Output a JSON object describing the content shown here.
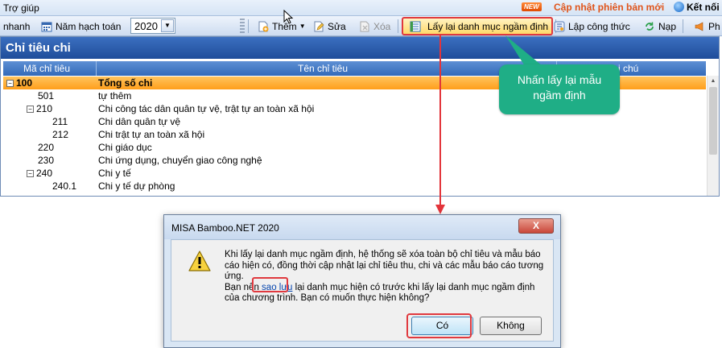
{
  "menubar": {
    "help": "Trợ giúp",
    "new_badge": "NEW",
    "update_link": "Cập nhật phiên bản mới",
    "connect": "Kết nối"
  },
  "toolbar": {
    "quick_label": "nhanh",
    "fiscal_year_label": "Năm hạch toán",
    "fiscal_year_value": "2020",
    "add": "Thêm",
    "edit": "Sửa",
    "delete": "Xóa",
    "restore_default": "Lấy lại danh mục ngầm định",
    "formula": "Lập công thức",
    "load": "Nạp",
    "more": "Ph"
  },
  "panel": {
    "title": "Chỉ tiêu chi",
    "columns": {
      "code": "Mã chỉ tiêu",
      "name": "Tên chỉ tiêu",
      "note": "Ghi chú"
    },
    "rows": [
      {
        "toggle": "−",
        "code": "100",
        "name": "Tổng số chi"
      },
      {
        "toggle": "",
        "code": "501",
        "name": "tự thêm"
      },
      {
        "toggle": "−",
        "code": "210",
        "name": "Chi công tác dân quân tự vệ, trật tự an toàn xã hội"
      },
      {
        "toggle": "",
        "code": "211",
        "name": "Chi dân quân tự vệ"
      },
      {
        "toggle": "",
        "code": "212",
        "name": "Chi trật tự an toàn xã hội"
      },
      {
        "toggle": "",
        "code": "220",
        "name": "Chi giáo dục"
      },
      {
        "toggle": "",
        "code": "230",
        "name": "Chi ứng dụng, chuyển giao công nghệ"
      },
      {
        "toggle": "−",
        "code": "240",
        "name": "Chi y tế"
      },
      {
        "toggle": "",
        "code": "240.1",
        "name": "Chi y tế dự phòng"
      }
    ]
  },
  "callout": {
    "text": "Nhấn lấy lại mẫu ngầm định"
  },
  "dialog": {
    "title": "MISA Bamboo.NET 2020",
    "close": "X",
    "message_line1": "Khi lấy lại danh mục ngầm định, hệ thống sẽ xóa toàn bộ chỉ tiêu và mẫu báo cáo hiện có, đồng thời cập nhật lại chỉ tiêu thu, chi và các mẫu báo cáo tương ứng.",
    "message_prefix": "Bạn nên ",
    "message_link": "sao lưu",
    "message_suffix": " lại danh mục hiện có trước khi lấy lại danh mục ngầm định của chương trình. Bạn có muốn thực hiện không?",
    "yes": "Có",
    "no": "Không"
  },
  "colors": {
    "title_bar": "#1f4d9a",
    "total_row": "#ff9e1b",
    "callout": "#1fae86",
    "highlight": "#e0393e"
  }
}
